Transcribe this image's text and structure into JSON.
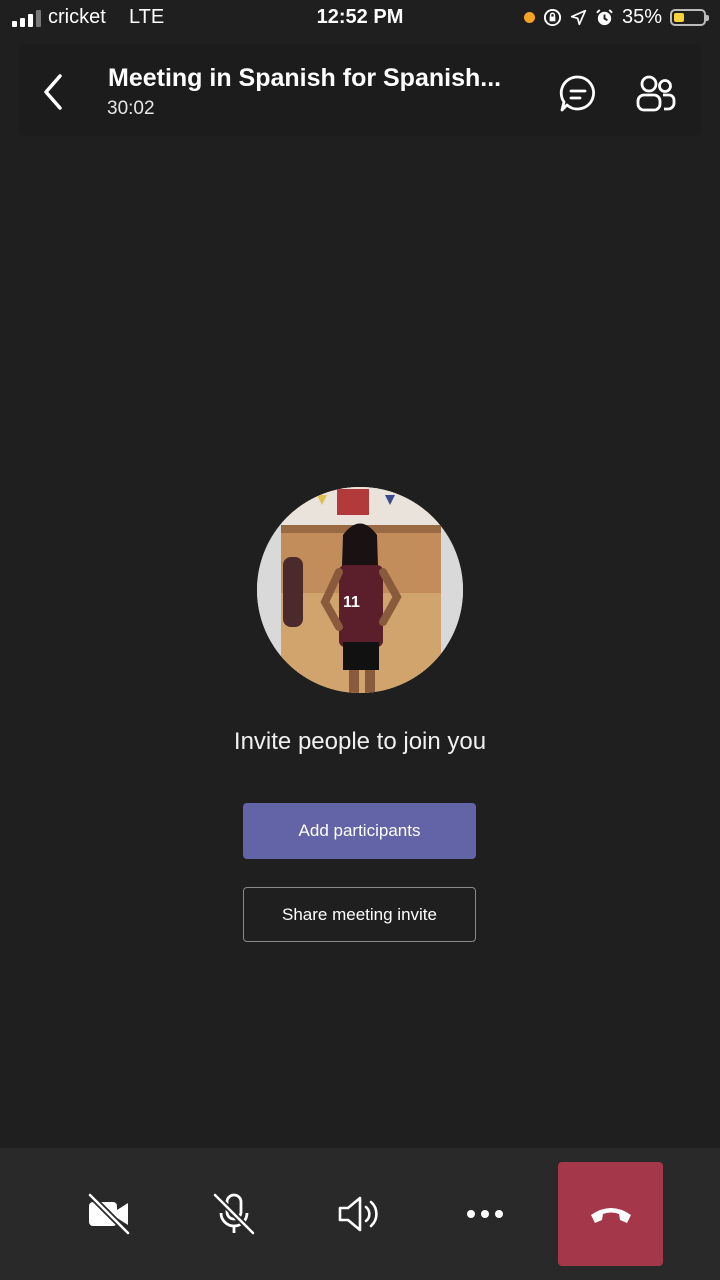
{
  "status_bar": {
    "carrier": "cricket",
    "network": "LTE",
    "time": "12:52 PM",
    "battery_percent": "35%",
    "battery_level": 0.35,
    "icons": [
      "signal-icon",
      "recording-dot-icon",
      "orientation-lock-icon",
      "location-icon",
      "alarm-icon",
      "battery-icon"
    ]
  },
  "header": {
    "title": "Meeting in Spanish for Spanish...",
    "duration": "30:02",
    "icons": [
      "back-chevron-icon",
      "chat-icon",
      "participants-icon"
    ]
  },
  "main": {
    "invite_text": "Invite people to join you",
    "add_participants_label": "Add participants",
    "share_invite_label": "Share meeting invite",
    "avatar": "participant-photo"
  },
  "controls": {
    "icons": [
      "camera-off-icon",
      "mic-off-icon",
      "speaker-icon",
      "more-icon",
      "hang-up-icon"
    ]
  },
  "colors": {
    "background": "#1f1f1f",
    "accent": "#6264a7",
    "end_call": "#a4374a",
    "control_bar": "#292929"
  }
}
